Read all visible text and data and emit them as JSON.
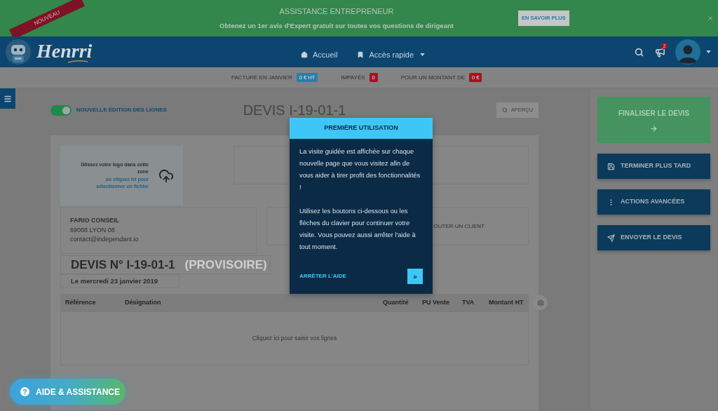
{
  "promo_banner": {
    "ribbon": "NOUVEAU",
    "title": "ASSISTANCE ENTREPRENEUR",
    "subtitle": "Obtenez un 1er avis d'Expert gratuit sur toutes vos questions de dirigeant",
    "button": "EN SAVOIR PLUS"
  },
  "header": {
    "logo": "Henrri",
    "nav": [
      {
        "label": "Accueil",
        "dropdown": false
      },
      {
        "label": "Accès rapide",
        "dropdown": true
      }
    ],
    "notifications_count": "2"
  },
  "stats": [
    {
      "label": "FACTURÉ EN JANVIER",
      "value": "0 € HT",
      "color": "#2a7fa8"
    },
    {
      "label": "IMPAYÉS",
      "value": "0",
      "color": "#a3141f"
    },
    {
      "label": "POUR UN MONTANT DE",
      "value": "0 €",
      "color": "#a3141f"
    }
  ],
  "editor": {
    "toggle": {
      "label": "NOUVELLE ÉDITION DES LIGNES",
      "on": true
    },
    "title": "DEVIS I-19-01-1",
    "preview_button": "APERÇU"
  },
  "document": {
    "logo_zone": {
      "text": "Glissez votre logo dans cette zone",
      "link": "ou cliquez ici pour sélectionner un fichier"
    },
    "company": {
      "name": "FARIO CONSEIL",
      "city": "69008 LYON 08",
      "email": "contact@independant.io"
    },
    "client_button": "OUTER UN CLIENT",
    "quote_number": "DEVIS N° I-19-01-1",
    "quote_status": "(PROVISOIRE)",
    "date": "Le mercredi 23 janvier 2019",
    "table": {
      "columns": [
        "Référence",
        "Désignation",
        "Quantité",
        "PU Vente",
        "TVA",
        "Montant HT"
      ],
      "empty_text": "Cliquez ici pour saisir vos lignes"
    }
  },
  "actions": [
    {
      "label": "FINALISER LE DEVIS",
      "kind": "primary"
    },
    {
      "label": "TERMINER PLUS TARD",
      "kind": "save"
    },
    {
      "label": "ACTIONS AVANCÉES",
      "kind": "more"
    },
    {
      "label": "ENVOYER LE DEVIS",
      "kind": "send"
    }
  ],
  "tour_popup": {
    "title": "PREMIÈRE UTILISATION",
    "paragraphs": [
      "La visite guidée est affichée sur chaque nouvelle page que vous visitez afin de vous aider à tirer profit des fonctionnalités !",
      "Utilisez les boutons ci-dessous ou les flèches du clavier pour continuer votre visite. Vous pouvez aussi arrêter l'aide à tout moment."
    ],
    "stop_link": "ARRÊTER L'AIDE",
    "next_button": "»"
  },
  "help_button": "AIDE & ASSISTANCE"
}
